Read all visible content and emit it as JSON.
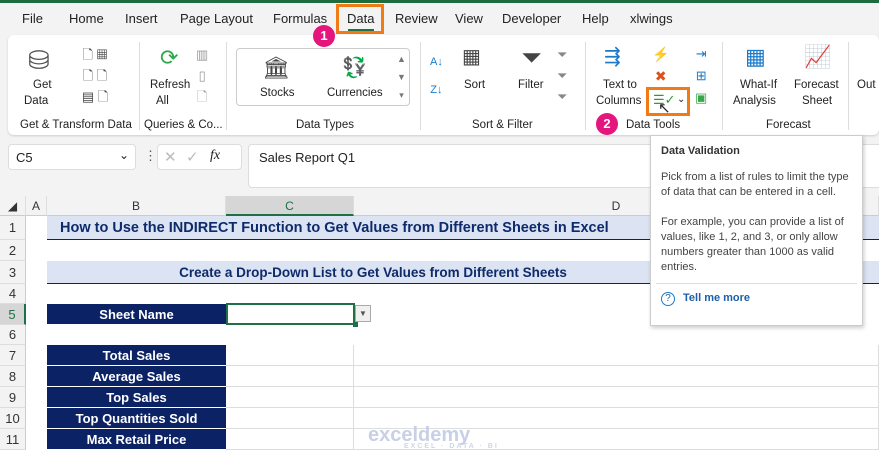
{
  "tabs": [
    "File",
    "Home",
    "Insert",
    "Page Layout",
    "Formulas",
    "Data",
    "Review",
    "View",
    "Developer",
    "Help",
    "xlwings"
  ],
  "active_tab": "Data",
  "steps": [
    "1",
    "2"
  ],
  "ribbon": {
    "get_transform": {
      "get_data": "Get",
      "get_data2": "Data",
      "label": "Get & Transform Data"
    },
    "queries": {
      "refresh": "Refresh",
      "refresh2": "All",
      "label": "Queries & Co..."
    },
    "data_types": {
      "stocks": "Stocks",
      "currencies": "Currencies",
      "label": "Data Types"
    },
    "sort_filter": {
      "sort": "Sort",
      "filter": "Filter",
      "label": "Sort & Filter"
    },
    "data_tools": {
      "text_to": "Text to",
      "columns": "Columns",
      "label": "Data Tools"
    },
    "forecast": {
      "whatif": "What-If",
      "analysis": "Analysis",
      "forecast": "Forecast",
      "sheet": "Sheet",
      "label": "Forecast"
    },
    "outline": {
      "label": "Out"
    }
  },
  "formula_bar": {
    "name_box": "C5",
    "fx": "fx",
    "value": "Sales Report Q1"
  },
  "columns": [
    "A",
    "B",
    "C",
    "D"
  ],
  "rows": [
    "1",
    "2",
    "3",
    "4",
    "5",
    "6",
    "7",
    "8",
    "9",
    "10",
    "11"
  ],
  "sheet": {
    "title": "How to Use the INDIRECT Function to Get Values from Different Sheets in Excel",
    "subtitle": "Create a Drop-Down List to Get Values from Different Sheets",
    "sheet_name_label": "Sheet Name",
    "metrics": [
      "Total Sales",
      "Average Sales",
      "Top Sales",
      "Top Quantities Sold",
      "Max Retail Price"
    ]
  },
  "tooltip": {
    "title": "Data Validation",
    "p1": "Pick from a list of rules to limit the type of data that can be entered in a cell.",
    "p2": "For example, you can provide a list of values, like 1, 2, and 3, or only allow numbers greater than 1000 as valid entries.",
    "link": "Tell me more"
  },
  "watermark": {
    "name": "exceldemy",
    "tag": "EXCEL · DATA · BI"
  },
  "colors": {
    "accent": "#1e7145",
    "highlight": "#f07b16",
    "badge": "#e4157d",
    "header_fill": "#0b2265",
    "band_fill": "#dce3f2"
  }
}
